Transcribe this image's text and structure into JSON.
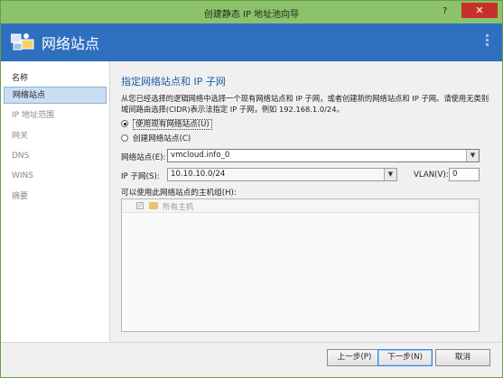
{
  "window": {
    "title": "创建静态 IP 地址池向导",
    "help": "?",
    "close": "✕"
  },
  "banner": {
    "heading": "网络站点"
  },
  "sidebar": {
    "title": "名称",
    "items": [
      {
        "label": "网络站点",
        "active": true
      },
      {
        "label": "IP 地址范围",
        "active": false
      },
      {
        "label": "网关",
        "active": false
      },
      {
        "label": "DNS",
        "active": false
      },
      {
        "label": "WINS",
        "active": false
      },
      {
        "label": "摘要",
        "active": false
      }
    ]
  },
  "main": {
    "section_title": "指定网络站点和 IP 子网",
    "description": "从您已经选择的逻辑网络中选择一个现有网络站点和 IP 子网，或者创建新的网络站点和 IP 子网。请使用无类别域间路由选择(CIDR)表示法指定 IP 子网，例如 192.168.1.0/24。",
    "radio_existing": "使用现有网络站点(U)",
    "radio_new": "创建网络站点(C)",
    "site_label": "网络站点(E):",
    "site_value": "vmcloud.info_0",
    "subnet_label": "IP 子网(S):",
    "subnet_value": "10.10.10.0/24",
    "vlan_label": "VLAN(V):",
    "vlan_value": "0",
    "hostgroups_label": "可以使用此网络站点的主机组(H):",
    "hostgroup_item": "所有主机"
  },
  "footer": {
    "back": "上一步(P)",
    "next": "下一步(N)",
    "cancel": "取消"
  }
}
